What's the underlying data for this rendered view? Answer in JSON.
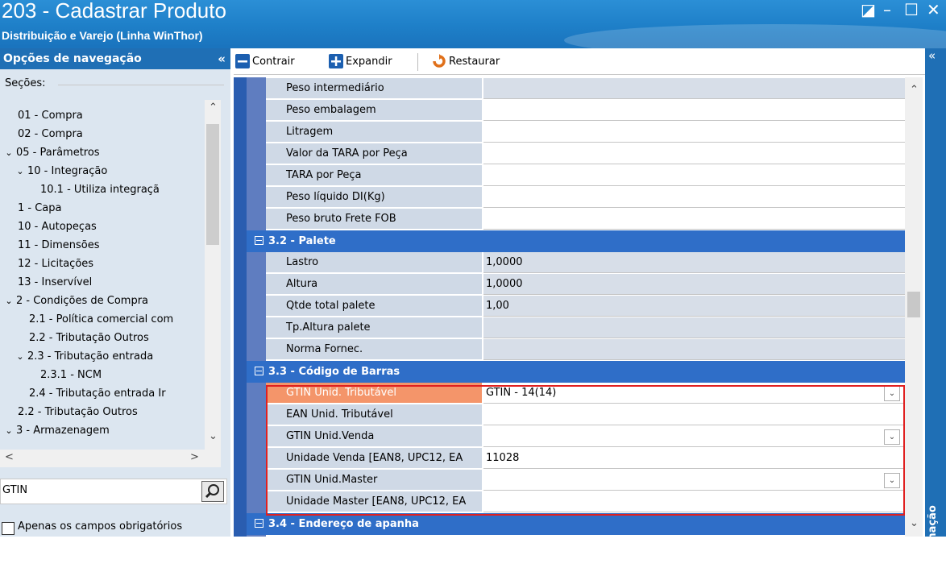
{
  "window": {
    "title": "203 - Cadastrar  Produto",
    "subtitle": "Distribuição e Varejo (Linha WinThor)",
    "controls": [
      "◪",
      "–",
      "☐",
      "✕"
    ]
  },
  "nav": {
    "header": "Opções de navegação",
    "collapse": "«",
    "sections_label": "Seções:",
    "tree": [
      {
        "label": "01 - Compra",
        "level": 0,
        "expander": ""
      },
      {
        "label": "02 - Compra",
        "level": 0,
        "expander": ""
      },
      {
        "label": "05 - Parâmetros",
        "level": 0,
        "expander": "⌄"
      },
      {
        "label": "10 - Integração",
        "level": 1,
        "expander": "⌄"
      },
      {
        "label": "10.1 - Utiliza integraçã",
        "level": 2,
        "expander": ""
      },
      {
        "label": "1 - Capa",
        "level": 0,
        "expander": ""
      },
      {
        "label": "10 - Autopeças",
        "level": 0,
        "expander": ""
      },
      {
        "label": "11 - Dimensões",
        "level": 0,
        "expander": ""
      },
      {
        "label": "12 - Licitações",
        "level": 0,
        "expander": ""
      },
      {
        "label": "13 - Inservível",
        "level": 0,
        "expander": ""
      },
      {
        "label": "2 - Condições de Compra",
        "level": 0,
        "expander": "⌄"
      },
      {
        "label": "2.1 - Política comercial com",
        "level": 1,
        "expander": ""
      },
      {
        "label": "2.2 - Tributação Outros",
        "level": 1,
        "expander": ""
      },
      {
        "label": "2.3 - Tributação entrada",
        "level": 1,
        "expander": "⌄"
      },
      {
        "label": "2.3.1 - NCM",
        "level": 2,
        "expander": ""
      },
      {
        "label": "2.4 - Tributação entrada Ir",
        "level": 1,
        "expander": ""
      },
      {
        "label": "2.2 - Tributação Outros",
        "level": 0,
        "expander": ""
      },
      {
        "label": "3 - Armazenagem",
        "level": 0,
        "expander": "⌄"
      }
    ],
    "search_value": "GTIN",
    "checkbox_label": "Apenas os campos obrigatórios"
  },
  "toolbar": {
    "contrair": "Contrair",
    "expandir": "Expandir",
    "restaurar": "Restaurar"
  },
  "grid": {
    "rows_top": [
      {
        "label": "Peso intermediário",
        "value": "",
        "gray": true
      },
      {
        "label": "Peso embalagem",
        "value": "",
        "gray": false
      },
      {
        "label": "Litragem",
        "value": "",
        "gray": false
      },
      {
        "label": "Valor da TARA por Peça",
        "value": "",
        "gray": false
      },
      {
        "label": "TARA por Peça",
        "value": "",
        "gray": false
      },
      {
        "label": "Peso líquido DI(Kg)",
        "value": "",
        "gray": false
      },
      {
        "label": "Peso bruto Frete FOB",
        "value": "",
        "gray": false
      }
    ],
    "section_palete": "3.2 - Palete",
    "rows_palete": [
      {
        "label": "Lastro",
        "value": "1,0000",
        "gray": true
      },
      {
        "label": "Altura",
        "value": "1,0000",
        "gray": true
      },
      {
        "label": "Qtde total palete",
        "value": "1,00",
        "gray": true
      },
      {
        "label": "Tp.Altura palete",
        "value": "",
        "gray": true
      },
      {
        "label": "Norma Fornec.",
        "value": "",
        "gray": true
      }
    ],
    "section_barras": "3.3 - Código de Barras",
    "rows_barras": [
      {
        "label": "GTIN Unid. Tributável",
        "value": "GTIN - 14(14)",
        "dropdown": true,
        "selected": true
      },
      {
        "label": "EAN Unid. Tributável",
        "value": "",
        "dropdown": false
      },
      {
        "label": "GTIN Unid.Venda",
        "value": "",
        "dropdown": true
      },
      {
        "label": "Unidade Venda [EAN8, UPC12, EA",
        "value": "11028",
        "dropdown": false
      },
      {
        "label": "GTIN Unid.Master",
        "value": "",
        "dropdown": true
      },
      {
        "label": "Unidade Master [EAN8, UPC12, EA",
        "value": "",
        "dropdown": false
      }
    ],
    "section_endereco": "3.4 - Endereço de apanha"
  },
  "right_panel": {
    "collapse": "«",
    "label": "Informação"
  },
  "colors": {
    "accent": "#1f6fb5",
    "section": "#2f6ec8",
    "selected_label": "#f4956a",
    "highlight_border": "#e02020"
  }
}
